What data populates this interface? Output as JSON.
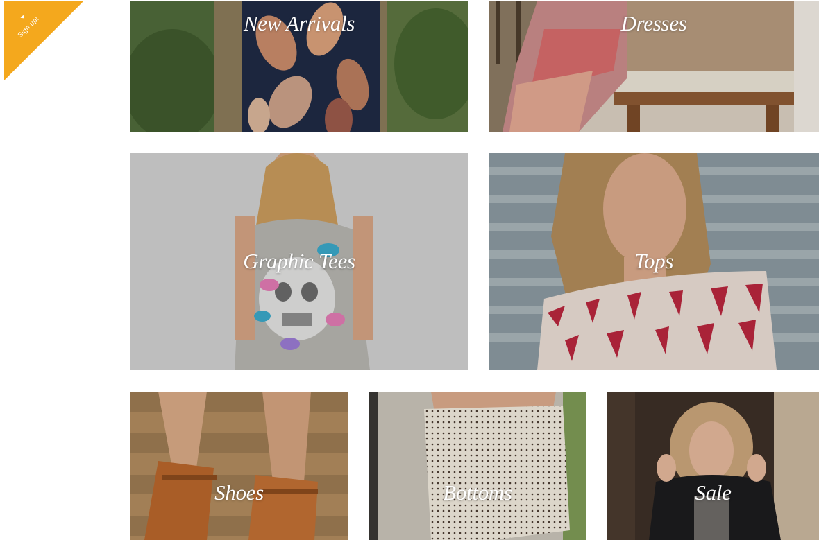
{
  "signup": {
    "label": "Sign up!",
    "color": "#F4A81D",
    "icon": "caret-up-icon"
  },
  "categories": [
    {
      "id": "new-arrivals",
      "label": "New Arrivals"
    },
    {
      "id": "dresses",
      "label": "Dresses"
    },
    {
      "id": "graphic-tees",
      "label": "Graphic Tees"
    },
    {
      "id": "tops",
      "label": "Tops"
    },
    {
      "id": "shoes",
      "label": "Shoes"
    },
    {
      "id": "bottoms",
      "label": "Bottoms"
    },
    {
      "id": "sale",
      "label": "Sale"
    }
  ]
}
